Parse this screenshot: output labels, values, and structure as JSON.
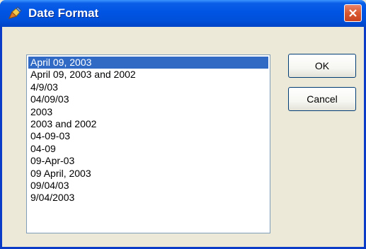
{
  "window": {
    "title": "Date Format",
    "title_icon": "pencil-icon",
    "close_icon": "close-icon"
  },
  "list": {
    "selected_index": 0,
    "items": [
      "April 09, 2003",
      "April 09, 2003 and 2002",
      "4/9/03",
      "04/09/03",
      "2003",
      "2003 and 2002",
      "04-09-03",
      "04-09",
      "09-Apr-03",
      "09 April, 2003",
      "09/04/03",
      "9/04/2003"
    ]
  },
  "buttons": {
    "ok_label": "OK",
    "cancel_label": "Cancel"
  },
  "colors": {
    "titlebar": "#0054e3",
    "selection": "#316ac5",
    "dialog_bg": "#ece9d8",
    "close_button": "#d9582f"
  }
}
